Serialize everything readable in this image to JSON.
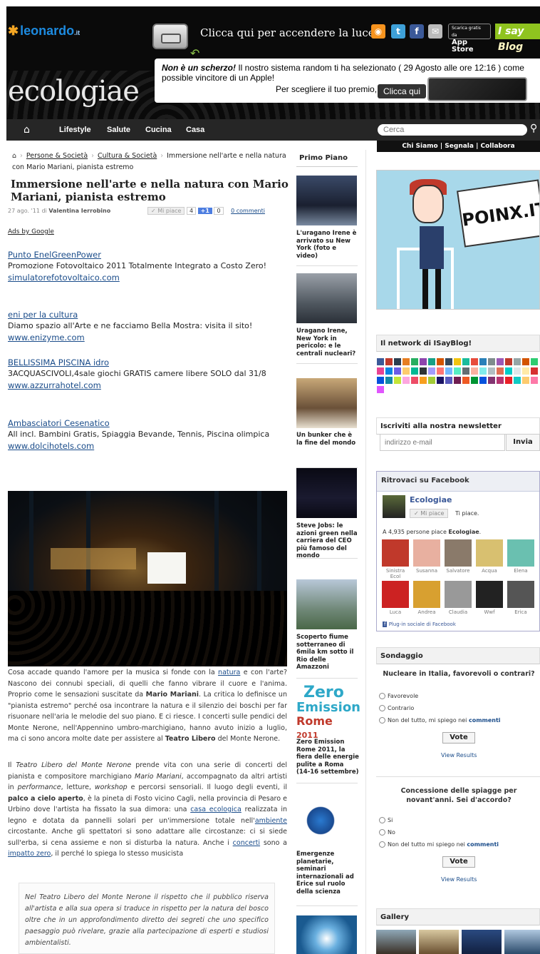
{
  "header": {
    "leo_logo": "leonardo",
    "leo_suffix": ".it",
    "eco_logo": "ecologiae",
    "light_text": "Clicca qui per accendere la luce",
    "social": [
      {
        "icon": "rss-icon",
        "glyph": "◉",
        "color": "#f7931e"
      },
      {
        "icon": "twitter-icon",
        "glyph": "t",
        "color": "#3ea0d8"
      },
      {
        "icon": "facebook-icon",
        "glyph": "f",
        "color": "#3b5998"
      },
      {
        "icon": "mail-icon",
        "glyph": "✉",
        "color": "#bbbbbb"
      }
    ],
    "appstore_small": "Scarica gratis da",
    "appstore": "App Store",
    "isay": "I say",
    "isay_b": "Blog",
    "promo_bold": "Non è un scherzo!",
    "promo_text": " Il nostro sistema random ti ha selezionato ( 29 Agosto alle ore 12:16 ) come possible vincitore di un Apple!",
    "promo_line2": "Per scegliere il tuo premio,",
    "promo_button": "Clicca qui"
  },
  "nav": {
    "items": [
      "Lifestyle",
      "Salute",
      "Cucina",
      "Casa"
    ],
    "search_placeholder": "Cerca",
    "subnav": "Chi Siamo  |  Segnala  |  Collabora"
  },
  "breadcrumb": {
    "items": [
      "Persone & Società",
      "Cultura & Società"
    ],
    "current": "Immersione nell'arte e nella natura con Mario Mariani, pianista estremo"
  },
  "article": {
    "title": "Immersione nell'arte e nella natura con Mario Mariani, pianista estremo",
    "date": "27 ago. '11 di ",
    "author": "Valentina Ierrobino",
    "fb_like": "✓ Mi piace",
    "fb_count": "4",
    "plus": "+1",
    "plus_count": "0",
    "comments": "0 commenti",
    "p1_pre": "Cosa accade quando l'amore per la musica si fonde con la ",
    "p1_link": "natura",
    "p1_post": " e con l'arte? Nascono dei connubi speciali, di quelli che fanno vibrare il cuore e l'anima. Proprio come le sensazioni suscitate da ",
    "p1_bold": "Mario Mariani",
    "p1_end": ". La critica lo definisce un \"pianista estremo\" perché osa incontrare la natura e il silenzio dei boschi per far risuonare nell'aria le melodie del suo piano. E ci riesce. I concerti sulle pendici del Monte Nerone, nell'Appennino umbro-marchigiano, hanno avuto inizio a luglio, ma ci sono ancora molte date per assistere al ",
    "p1_bold2": "Teatro Libero",
    "p1_tail": " del Monte Nerone.",
    "p2_a": "Il ",
    "p2_i1": "Teatro Libero del Monte Nerone",
    "p2_b": " prende vita con una serie di concerti del pianista e compositore marchigiano ",
    "p2_i2": "Mario Mariani",
    "p2_c": ", accompagnato da altri artisti in ",
    "p2_i3": "performance",
    "p2_d": ", letture, ",
    "p2_i4": "workshop",
    "p2_e": " e percorsi sensoriali. Il luogo degli eventi, il ",
    "p2_bold": "palco a cielo aperto",
    "p2_f": ", è la pineta di Fosto vicino Cagli, nella provincia di Pesaro e Urbino dove l'artista ha fissato la sua dimora: una ",
    "p2_l1": "casa ecologica",
    "p2_g": " realizzata in legno e dotata da pannelli solari per un'immersione totale nell'",
    "p2_l2": "ambiente",
    "p2_h": " circostante. Anche gli spettatori si sono adattare alle circostanze: ci si siede sull'erba, si cena assieme e non si disturba la natura. Anche i ",
    "p2_l3": "concerti",
    "p2_i": " sono a ",
    "p2_l4": "impatto zero",
    "p2_j": ", il perché lo spiega lo stesso musicista",
    "quote": "Nel Teatro Libero del Monte Nerone il rispetto che il pubblico riserva all'artista e alla sua opera si traduce in rispetto per la natura del bosco oltre che in un approfondimento diretto dei segreti che uno specifico paesaggio può rivelare, grazie alla partecipazione di esperti e studiosi ambientalisti."
  },
  "ads": {
    "label": "Ads by Google",
    "items": [
      {
        "title": "Punto EnelGreenPower",
        "text": "Promozione Fotovoltaico 2011 Totalmente Integrato a Costo Zero!",
        "url": "simulatorefotovoltaico.com"
      },
      {
        "title": "eni per la cultura",
        "text": "Diamo spazio all'Arte e ne facciamo Bella Mostra: visita il sito!",
        "url": "www.enizyme.com"
      },
      {
        "title": "BELLISSIMA PISCINA idro",
        "text": "3ACQUASCIVOLI,4sale giochi GRATIS camere libere SOLO dal 31/8",
        "url": "www.azzurrahotel.com"
      },
      {
        "title": "Ambasciatori Cesenatico",
        "text": "All incl. Bambini Gratis, Spiaggia Bevande, Tennis, Piscina olimpica",
        "url": "www.dolcihotels.com"
      }
    ]
  },
  "primo_piano": {
    "title": "Primo Piano",
    "items": [
      "L'uragano Irene è arrivato su New York (foto e video)",
      "Uragano Irene, New York in pericolo: e le centrali nucleari?",
      "Un bunker che è la fine del mondo",
      "Steve Jobs: le azioni green nella carriera del CEO più famoso del mondo",
      "Scoperto fiume sotterraneo di 6mila km sotto il Rio delle Amazzoni",
      "Zero Emission Rome 2011, la fiera delle energie pulite a Roma (14-16 settembre)",
      "Emergenze planetarie, seminari internazionali ad Erice sul ruolo della scienza"
    ],
    "zero_title": "Zero",
    "zero_sub": "Emission",
    "zero_rome": "Rome",
    "zero_year": "2011"
  },
  "sidebar": {
    "poinx": "POINX.IT",
    "network_title": "Il network di ISayBlog!",
    "network_colors": [
      "#3b5998",
      "#c0392b",
      "#2c3e50",
      "#e67e22",
      "#27ae60",
      "#8e44ad",
      "#16a085",
      "#d35400",
      "#34495e",
      "#f1c40f",
      "#1abc9c",
      "#e74c3c",
      "#2980b9",
      "#7f8c8d",
      "#9b59b6",
      "#c0392b",
      "#95a5a6",
      "#d35400",
      "#2ecc71",
      "#e84393",
      "#0984e3",
      "#6c5ce7",
      "#fdcb6e",
      "#00b894",
      "#2d3436",
      "#a29bfe",
      "#ff7675",
      "#74b9ff",
      "#55efc4",
      "#636e72",
      "#fab1a0",
      "#81ecec",
      "#b2bec3",
      "#e17055",
      "#00cec9",
      "#dfe6e9",
      "#ffeaa7",
      "#d63031",
      "#0652dd",
      "#1289a7",
      "#c4e538",
      "#fda7df",
      "#ed4c67",
      "#f79f1f",
      "#a3cb38",
      "#1b1464",
      "#5758bb",
      "#6f1e51",
      "#ee5a24",
      "#009432",
      "#0652dd",
      "#833471",
      "#b53471",
      "#ea2027",
      "#12cbc4",
      "#fdcb6e",
      "#fd79a8",
      "#e056fd"
    ],
    "newsletter_title": "Iscriviti alla nostra newsletter",
    "newsletter_placeholder": "indirizzo e-mail",
    "newsletter_btn": "Invia",
    "fb_title": "Ritrovaci su Facebook",
    "fb_name": "Ecologiae",
    "fb_like": "✓ Mi piace",
    "fb_likes": "Ti piace.",
    "fb_count_pre": "A 4,935 persone piace ",
    "fb_count_bold": "Ecologiae",
    "fb_count_post": ".",
    "fans": [
      {
        "name": "Sinistra Ecol",
        "color": "#c0392b"
      },
      {
        "name": "Susanna",
        "color": "#e8b0a0"
      },
      {
        "name": "Salvatore",
        "color": "#8a7a6a"
      },
      {
        "name": "Acqua",
        "color": "#d8c070"
      },
      {
        "name": "Elena",
        "color": "#6ac0b0"
      },
      {
        "name": "Luca",
        "color": "#cc2222"
      },
      {
        "name": "Andrea",
        "color": "#d8a030"
      },
      {
        "name": "Claudia",
        "color": "#999999"
      },
      {
        "name": "Wwf",
        "color": "#222222"
      },
      {
        "name": "Erica",
        "color": "#555555"
      }
    ],
    "fb_plugin": "Plug-in sociale di Facebook",
    "poll_title": "Sondaggio",
    "poll1_q": "Nucleare in Italia, favorevoli o contrari?",
    "poll1_opts": [
      "Favorevole",
      "Contrario"
    ],
    "poll1_last_pre": "Non del tutto, mi spiego nei ",
    "poll1_last_link": "commenti",
    "poll2_q": "Concessione delle spiagge per novant'anni. Sei d'accordo?",
    "poll2_opts": [
      "Si",
      "No"
    ],
    "poll2_last_pre": "Non del tutto mi spiego nei ",
    "poll2_last_link": "commenti",
    "vote": "Vote",
    "view_results": "View Results",
    "gallery_title": "Gallery"
  }
}
